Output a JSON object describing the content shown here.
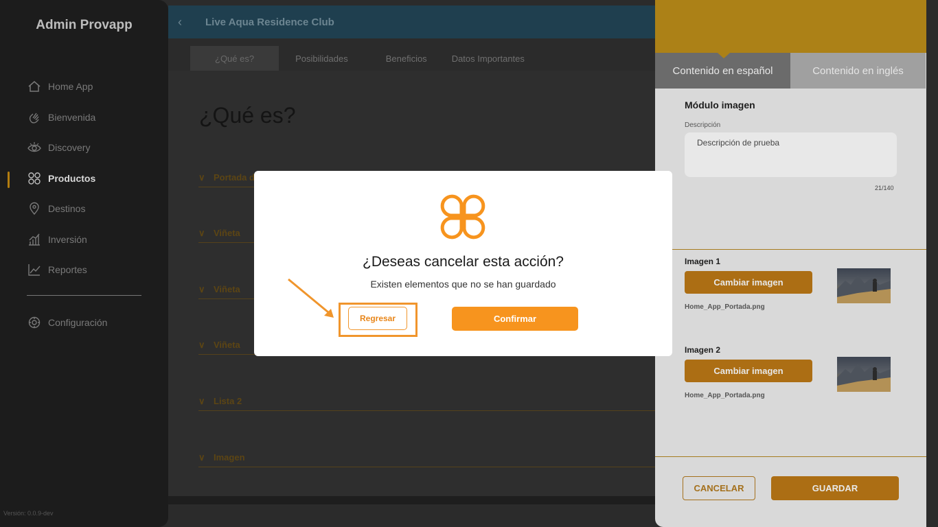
{
  "sidebar": {
    "brand": "Admin Provapp",
    "items": [
      {
        "label": "Home App",
        "icon": "home-icon"
      },
      {
        "label": "Bienvenida",
        "icon": "hand-wave-icon"
      },
      {
        "label": "Discovery",
        "icon": "eye-icon"
      },
      {
        "label": "Productos",
        "icon": "grid-icon"
      },
      {
        "label": "Destinos",
        "icon": "location-pin-icon"
      },
      {
        "label": "Inversión",
        "icon": "bar-chart-icon"
      },
      {
        "label": "Reportes",
        "icon": "line-chart-icon"
      },
      {
        "label": "Configuración",
        "icon": "gear-icon"
      }
    ],
    "active_item": "Productos",
    "version": "Versión: 0.0.9-dev"
  },
  "main": {
    "header_title": "Live Aqua Residence Club",
    "tabs": [
      "¿Qué es?",
      "Posibilidades",
      "Beneficios",
      "Datos Importantes"
    ],
    "active_tab": "¿Qué es?",
    "page_title": "¿Qué es?",
    "accordions": [
      "Portada d",
      "Viñeta",
      "Viñeta",
      "Viñeta",
      "Lista 2",
      "Imagen"
    ]
  },
  "drawer": {
    "tabs": [
      "Contenido en español",
      "Contenido en inglés"
    ],
    "active_tab": "Contenido en español",
    "section_title": "Módulo imagen",
    "description_label": "Descripción",
    "description_value": "Descripción de prueba",
    "char_count": "21/140",
    "images": [
      {
        "label": "Imagen 1",
        "button": "Cambiar imagen",
        "filename": "Home_App_Portada.png"
      },
      {
        "label": "Imagen 2",
        "button": "Cambiar imagen",
        "filename": "Home_App_Portada.png"
      }
    ],
    "cancel_label": "CANCELAR",
    "save_label": "GUARDAR"
  },
  "modal": {
    "title": "¿Deseas cancelar esta acción?",
    "subtitle": "Existen elementos que no se han guardado",
    "back_label": "Regresar",
    "confirm_label": "Confirmar"
  },
  "colors": {
    "accent": "#f7941e",
    "drawer_header": "#ac8117",
    "topbar": "#1f3f4f",
    "sidebar_bg": "#1c1c1c"
  }
}
